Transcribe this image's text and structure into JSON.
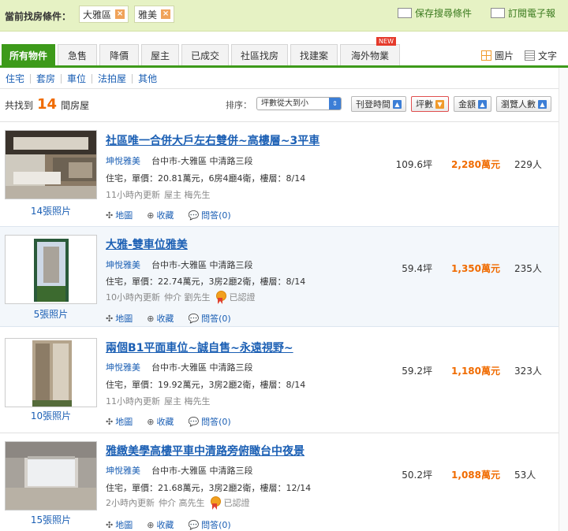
{
  "filter": {
    "label": "當前找房條件：",
    "chips": [
      "大雅區",
      "雅美"
    ],
    "save_search": "保存搜尋條件",
    "subscribe": "訂閱電子報"
  },
  "tabs": [
    {
      "label": "所有物件",
      "active": true
    },
    {
      "label": "急售"
    },
    {
      "label": "降價"
    },
    {
      "label": "屋主"
    },
    {
      "label": "已成交"
    },
    {
      "label": "社區找房"
    },
    {
      "label": "找建案"
    },
    {
      "label": "海外物業",
      "badge": "NEW"
    }
  ],
  "view_switch": {
    "photo": "圖片",
    "text": "文字"
  },
  "subnav": [
    "住宅",
    "套房",
    "車位",
    "法拍屋",
    "其他"
  ],
  "result": {
    "prefix": "共找到",
    "count": "14",
    "suffix": "間房屋"
  },
  "sort": {
    "label": "排序：",
    "selected": "坪數從大到小",
    "buttons": [
      {
        "label": "刊登時間",
        "dir": "up"
      },
      {
        "label": "坪數",
        "dir": "down",
        "selected": true
      },
      {
        "label": "金額",
        "dir": "up"
      },
      {
        "label": "瀏覽人數",
        "dir": "up"
      }
    ]
  },
  "listings": [
    {
      "title": "社區唯一合併大戶左右雙併~高樓層~3平車",
      "community": "坤悅雅美",
      "location": "台中市-大雅區 中清路三段",
      "details": "住宅，單價：20.81萬元，6房4廳4衛，樓層：8/14",
      "updated": "11小時內更新",
      "poster": "屋主 梅先生",
      "certified": "",
      "photos": "14張照片",
      "area": "109.6坪",
      "price": "2,280萬元",
      "views": "229人"
    },
    {
      "title": "大雅-雙車位雅美",
      "community": "坤悅雅美",
      "location": "台中市-大雅區 中清路三段",
      "details": "住宅，單價：22.74萬元，3房2廳2衛，樓層：8/14",
      "updated": "10小時內更新",
      "poster": "仲介 劉先生",
      "certified": "已認證",
      "photos": "5張照片",
      "area": "59.4坪",
      "price": "1,350萬元",
      "views": "235人"
    },
    {
      "title": "兩個B1平面車位~誠自售~永遠視野~",
      "community": "坤悅雅美",
      "location": "台中市-大雅區 中清路三段",
      "details": "住宅，單價：19.92萬元，3房2廳2衛，樓層：8/14",
      "updated": "11小時內更新",
      "poster": "屋主 梅先生",
      "certified": "",
      "photos": "10張照片",
      "area": "59.2坪",
      "price": "1,180萬元",
      "views": "323人"
    },
    {
      "title": "雅緻美學高樓平車中清路旁俯瞰台中夜景",
      "community": "坤悅雅美",
      "location": "台中市-大雅區 中清路三段",
      "details": "住宅，單價：21.68萬元，3房2廳2衛，樓層：12/14",
      "updated": "2小時內更新",
      "poster": "仲介 高先生",
      "certified": "已認證",
      "photos": "15張照片",
      "area": "50.2坪",
      "price": "1,088萬元",
      "views": "53人"
    }
  ],
  "actions": {
    "map": "地圖",
    "fav": "收藏",
    "qa": "問答(0)"
  },
  "colors": {
    "accent": "#3d9a1a",
    "link": "#1b5fb4",
    "price": "#f06b00",
    "filter_bg": "#e6f2c4"
  }
}
